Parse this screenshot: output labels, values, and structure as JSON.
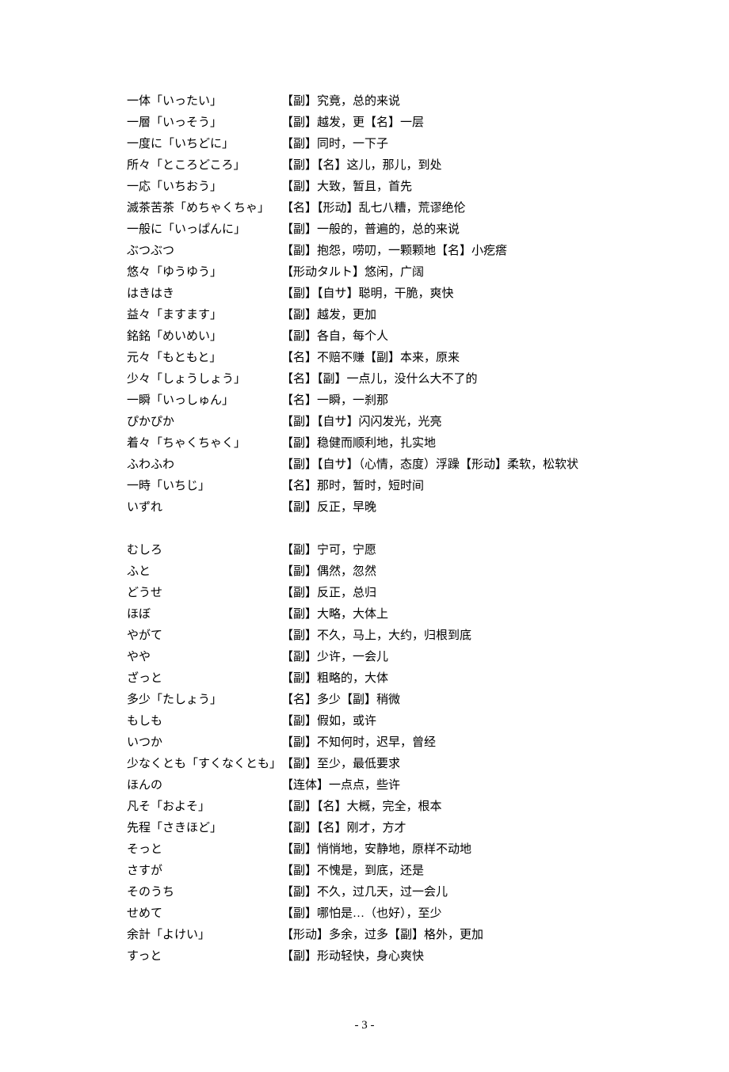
{
  "entries_a": [
    {
      "term": "一体「いったい」",
      "def": "【副】究竟，总的来说"
    },
    {
      "term": "一層「いっそう」",
      "def": "【副】越发，更【名】一层"
    },
    {
      "term": "一度に「いちどに」",
      "def": "【副】同时，一下子"
    },
    {
      "term": "所々「ところどころ」",
      "def": "【副】【名】这儿，那儿，到处"
    },
    {
      "term": "一応「いちおう」",
      "def": "【副】大致，暂且，首先"
    },
    {
      "term": "滅茶苦茶「めちゃくちゃ」",
      "def": "【名】【形动】乱七八糟，荒谬绝伦"
    },
    {
      "term": "一般に「いっぱんに」",
      "def": "【副】一般的，普遍的，总的来说"
    },
    {
      "term": "ぶつぶつ",
      "def": "【副】抱怨，唠叨，一颗颗地【名】小疙瘩"
    },
    {
      "term": "悠々「ゆうゆう」",
      "def": "【形动タルト】悠闲，广阔"
    },
    {
      "term": "はきはき",
      "def": "【副】【自サ】聪明，干脆，爽快"
    },
    {
      "term": "益々「ますます」",
      "def": "【副】越发，更加"
    },
    {
      "term": "銘銘「めいめい」",
      "def": "【副】各自，每个人"
    },
    {
      "term": "元々「もともと」",
      "def": "【名】不赔不赚【副】本来，原来"
    },
    {
      "term": "少々「しょうしょう」",
      "def": "【名】【副】一点儿，没什么大不了的"
    },
    {
      "term": "一瞬「いっしゅん」",
      "def": "【名】一瞬，一刹那"
    },
    {
      "term": "ぴかぴか",
      "def": "【副】【自サ】闪闪发光，光亮"
    },
    {
      "term": "着々「ちゃくちゃく」",
      "def": "【副】稳健而顺利地，扎实地"
    },
    {
      "term": "ふわふわ",
      "def": "【副】【自サ】（心情，态度）浮躁【形动】柔软，松软状"
    },
    {
      "term": "一時「いちじ」",
      "def": "【名】那时，暂时，短时间"
    },
    {
      "term": "いずれ",
      "def": "【副】反正，早晚"
    }
  ],
  "entries_b": [
    {
      "term": "むしろ",
      "def": "【副】宁可，宁愿"
    },
    {
      "term": "ふと",
      "def": "【副】偶然，忽然"
    },
    {
      "term": "どうせ",
      "def": "【副】反正，总归"
    },
    {
      "term": "ほぼ",
      "def": "【副】大略，大体上"
    },
    {
      "term": "やがて",
      "def": "【副】不久，马上，大约，归根到底"
    },
    {
      "term": "やや",
      "def": "【副】少许，一会儿"
    },
    {
      "term": "ざっと",
      "def": "【副】粗略的，大体"
    },
    {
      "term": "多少「たしょう」",
      "def": "【名】多少【副】稍微"
    },
    {
      "term": "もしも",
      "def": "【副】假如，或许"
    },
    {
      "term": "いつか",
      "def": "【副】不知何时，迟早，曾经"
    },
    {
      "term": "少なくとも「すくなくとも」",
      "def": "【副】至少，最低要求"
    },
    {
      "term": "ほんの",
      "def": "【连体】一点点，些许"
    },
    {
      "term": "凡そ「およそ」",
      "def": "【副】【名】大概，完全，根本"
    },
    {
      "term": "先程「さきほど」",
      "def": "【副】【名】刚才，方才"
    },
    {
      "term": "そっと",
      "def": "【副】悄悄地，安静地，原样不动地"
    },
    {
      "term": "さすが",
      "def": "【副】不愧是，到底，还是"
    },
    {
      "term": "そのうち",
      "def": "【副】不久，过几天，过一会儿"
    },
    {
      "term": "せめて",
      "def": "【副】哪怕是…（也好），至少"
    },
    {
      "term": "余計「よけい」",
      "def": "【形动】多余，过多【副】格外，更加"
    },
    {
      "term": "すっと",
      "def": "【副】形动轻快，身心爽快"
    }
  ],
  "page_number": "- 3 -"
}
